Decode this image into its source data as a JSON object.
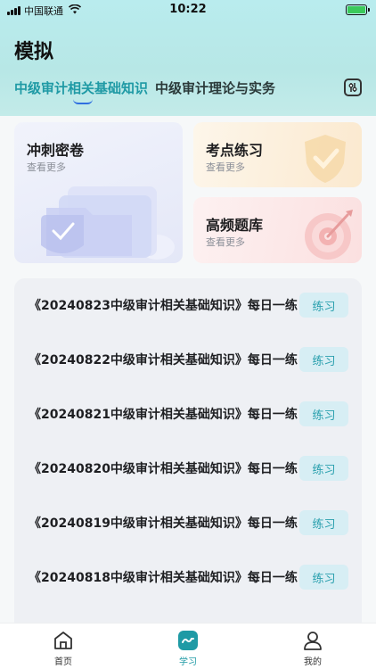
{
  "status_bar": {
    "carrier": "中国联通",
    "time": "10:22"
  },
  "page": {
    "title": "模拟"
  },
  "tabs": [
    {
      "label": "中级审计相关基础知识",
      "active": true
    },
    {
      "label": "中级审计理论与实务",
      "active": false
    }
  ],
  "cards": {
    "mock_paper": {
      "title": "冲刺密卷",
      "more": "查看更多"
    },
    "key_points": {
      "title": "考点练习",
      "more": "查看更多"
    },
    "frequent_bank": {
      "title": "高频题库",
      "more": "查看更多"
    }
  },
  "exam_list": {
    "action_label": "练习",
    "items": [
      {
        "title": "《20240823中级审计相关基础知识》每日一练"
      },
      {
        "title": "《20240822中级审计相关基础知识》每日一练"
      },
      {
        "title": "《20240821中级审计相关基础知识》每日一练"
      },
      {
        "title": "《20240820中级审计相关基础知识》每日一练"
      },
      {
        "title": "《20240819中级审计相关基础知识》每日一练"
      },
      {
        "title": "《20240818中级审计相关基础知识》每日一练"
      }
    ]
  },
  "bottom_nav": [
    {
      "label": "首页",
      "icon": "home-icon",
      "active": false
    },
    {
      "label": "学习",
      "icon": "study-icon",
      "active": true
    },
    {
      "label": "我的",
      "icon": "profile-icon",
      "active": false
    }
  ],
  "colors": {
    "accent": "#1f9aa5",
    "button_bg": "#d7eef4",
    "header_bg": "#b9ecee"
  }
}
